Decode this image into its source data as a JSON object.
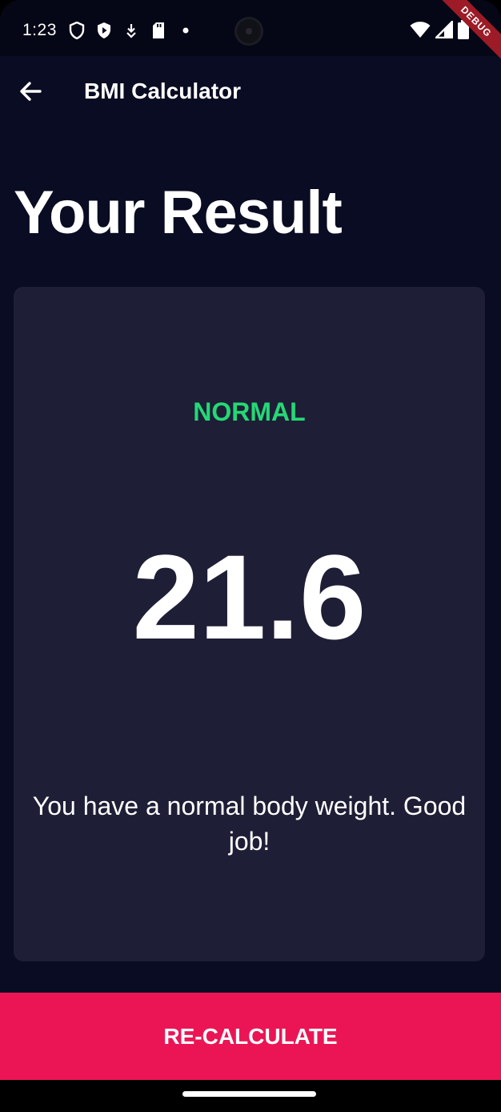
{
  "status_bar": {
    "time": "1:23",
    "left_icons": [
      "shield-outline-icon",
      "shield-play-icon",
      "download-icon",
      "sd-card-icon",
      "dot-icon"
    ],
    "right_icons": [
      "wifi-icon",
      "signal-icon",
      "battery-icon"
    ]
  },
  "debug_banner": "DEBUG",
  "app_bar": {
    "title": "BMI Calculator",
    "back_icon": "arrow-back-icon"
  },
  "result": {
    "heading": "Your Result",
    "status": "NORMAL",
    "bmi": "21.6",
    "interpretation": "You have a normal body weight. Good job!"
  },
  "actions": {
    "recalculate_label": "RE-CALCULATE"
  },
  "colors": {
    "background": "#090c22",
    "card": "#1e1e36",
    "status_green": "#24d876",
    "accent_pink": "#eb1555"
  }
}
